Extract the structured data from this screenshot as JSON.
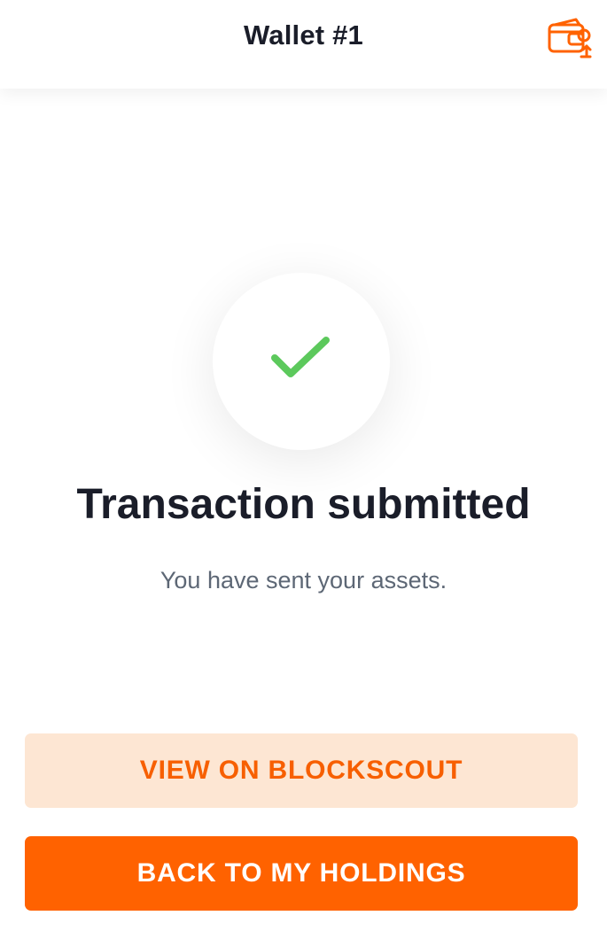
{
  "header": {
    "title": "Wallet #1",
    "switch_icon": "wallet-switch-icon"
  },
  "status": {
    "icon": "check-icon",
    "icon_color": "#5cc95c",
    "title": "Transaction submitted",
    "subtitle": "You have sent your assets."
  },
  "actions": {
    "view_explorer_label": "VIEW ON BLOCKSCOUT",
    "back_label": "BACK TO MY HOLDINGS"
  },
  "colors": {
    "accent": "#ff6200",
    "accent_light": "#fde6d3",
    "text_dark": "#1a1d29",
    "text_muted": "#5d6775"
  }
}
